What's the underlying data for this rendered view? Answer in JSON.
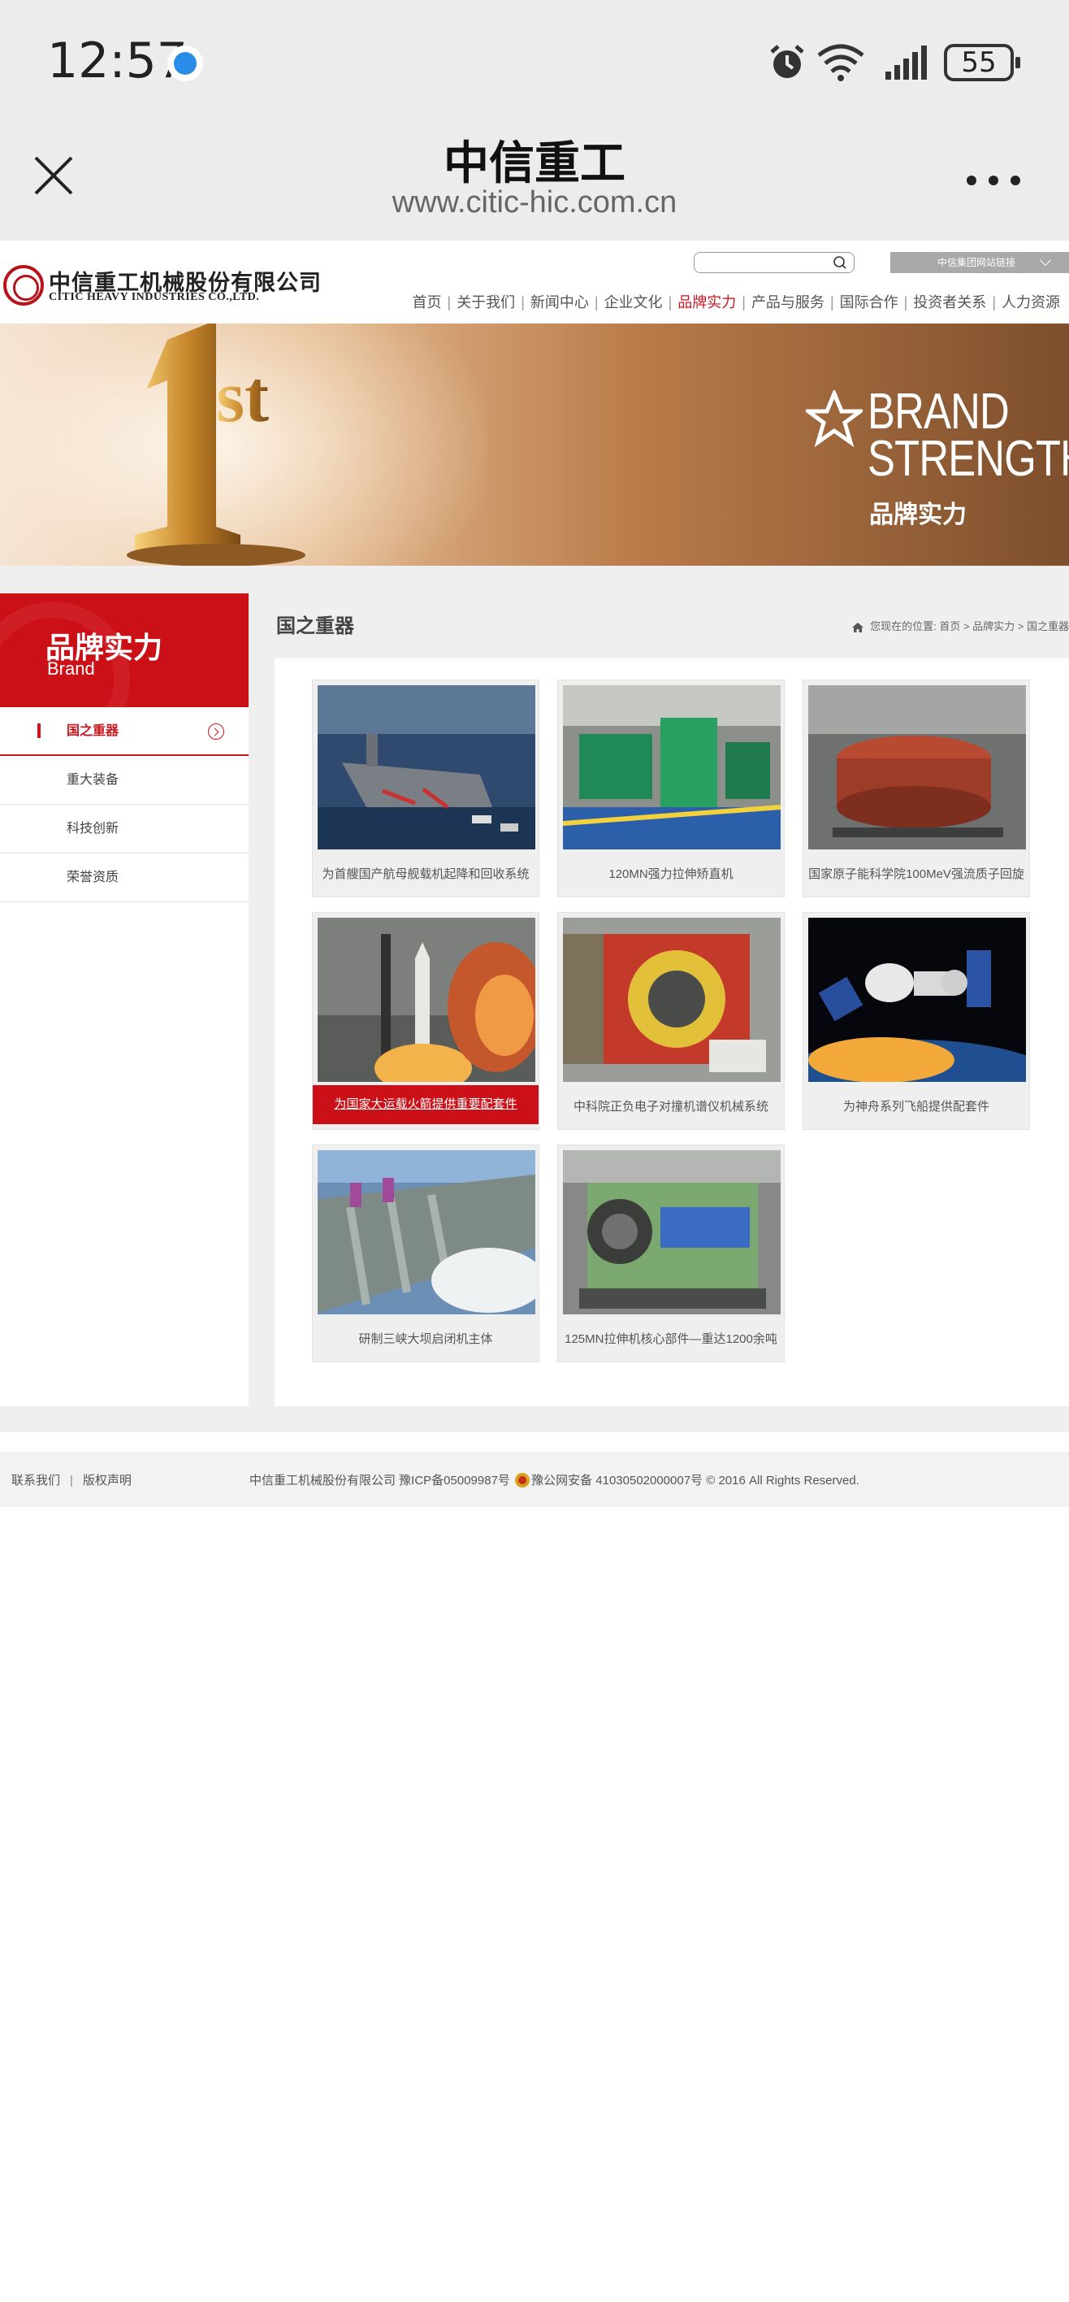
{
  "status_bar": {
    "time": "12:57",
    "battery": "55"
  },
  "browser": {
    "title": "中信重工",
    "url": "www.citic-hic.com.cn"
  },
  "header": {
    "logo_cn": "中信重工机械股份有限公司",
    "logo_en": "CITIC HEAVY INDUSTRIES CO.,LTD.",
    "group_links_label": "中信集团网站链接",
    "nav": [
      "首页",
      "关于我们",
      "新闻中心",
      "企业文化",
      "品牌实力",
      "产品与服务",
      "国际合作",
      "投资者关系",
      "人力资源"
    ],
    "active_nav": "品牌实力"
  },
  "banner": {
    "badge_1": "1",
    "badge_st": "st",
    "line1": "BRAND",
    "line2": "STRENGTH",
    "cn": "品牌实力"
  },
  "sidebar": {
    "title": "品牌实力",
    "subtitle": "Brand",
    "items": [
      "国之重器",
      "重大装备",
      "科技创新",
      "荣誉资质"
    ]
  },
  "main": {
    "title": "国之重器",
    "breadcrumb": "您现在的位置:  首页 > 品牌实力 > 国之重器",
    "cards": [
      {
        "caption": "为首艘国产航母舰载机起降和回收系统",
        "image": "aircraft-carrier"
      },
      {
        "caption": "120MN强力拉伸矫直机",
        "image": "green-machine"
      },
      {
        "caption": "国家原子能科学院100MeV强流质子回旋",
        "image": "red-cyclotron"
      },
      {
        "caption": "为国家大运载火箭提供重要配套件",
        "image": "rocket-launch"
      },
      {
        "caption": "中科院正负电子对撞机谱仪机械系统",
        "image": "collider-spectrometer"
      },
      {
        "caption": "为神舟系列飞船提供配套件",
        "image": "spacecraft"
      },
      {
        "caption": "研制三峡大坝启闭机主体",
        "image": "three-gorges-dam"
      },
      {
        "caption": "125MN拉伸机核心部件—重达1200余吨",
        "image": "press-machine"
      }
    ]
  },
  "footer": {
    "contact": "联系我们",
    "sep": "|",
    "copyright_link": "版权声明",
    "company": "中信重工机械股份有限公司 豫ICP备05009987号",
    "police": "豫公网安备 41030502000007号 © 2016 All Rights Reserved."
  }
}
